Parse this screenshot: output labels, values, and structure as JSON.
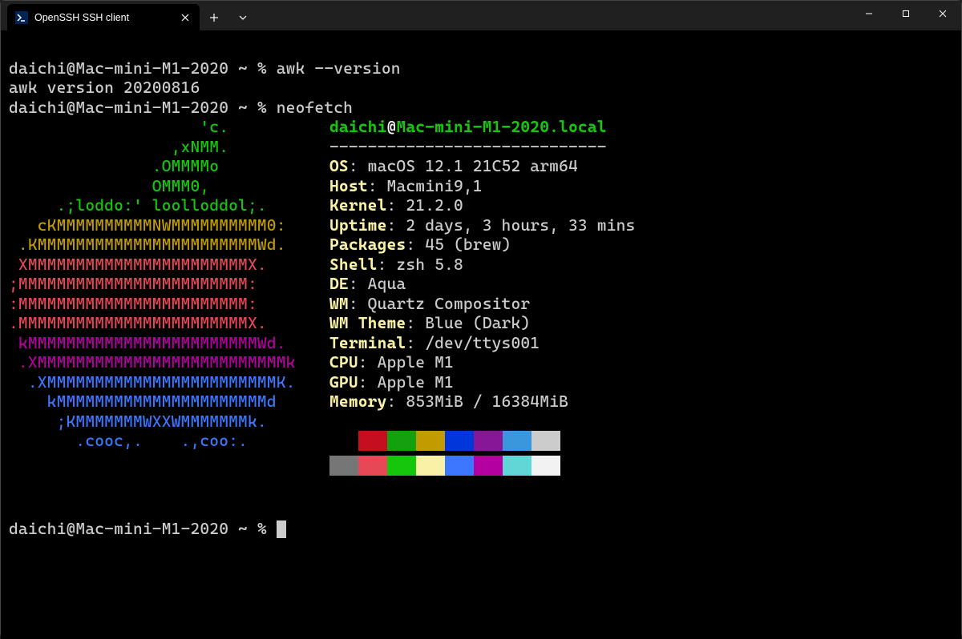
{
  "tab": {
    "title": "OpenSSH SSH client"
  },
  "prompt": "daichi@Mac-mini-M1-2020 ~ % ",
  "cmd1": "awk --version",
  "out1": "awk version 20200816",
  "cmd2": "neofetch",
  "ascii": [
    "                    'c.",
    "                 ,xNMM.",
    "               .OMMMMo",
    "               OMMM0,",
    "     .;loddo:' loolloddol;.",
    "   cKMMMMMMMMMMNWMMMMMMMMMM0:",
    " .KMMMMMMMMMMMMMMMMMMMMMMMWd.",
    " XMMMMMMMMMMMMMMMMMMMMMMMX.",
    ";MMMMMMMMMMMMMMMMMMMMMMMM:",
    ":MMMMMMMMMMMMMMMMMMMMMMMM:",
    ".MMMMMMMMMMMMMMMMMMMMMMMMX.",
    " kMMMMMMMMMMMMMMMMMMMMMMMMWd.",
    " .XMMMMMMMMMMMMMMMMMMMMMMMMMMk",
    "  .XMMMMMMMMMMMMMMMMMMMMMMMMK.",
    "    kMMMMMMMMMMMMMMMMMMMMMMd",
    "     ;KMMMMMMMWXXWMMMMMMMk.",
    "       .cooc,.    .,coo:."
  ],
  "user": "daichi",
  "at": "@",
  "host": "Mac-mini-M1-2020.local",
  "dashes": "-----------------------------",
  "info": [
    {
      "label": "OS",
      "value": "macOS 12.1 21C52 arm64"
    },
    {
      "label": "Host",
      "value": "Macmini9,1"
    },
    {
      "label": "Kernel",
      "value": "21.2.0"
    },
    {
      "label": "Uptime",
      "value": "2 days, 3 hours, 33 mins"
    },
    {
      "label": "Packages",
      "value": "45 (brew)"
    },
    {
      "label": "Shell",
      "value": "zsh 5.8"
    },
    {
      "label": "DE",
      "value": "Aqua"
    },
    {
      "label": "WM",
      "value": "Quartz Compositor"
    },
    {
      "label": "WM Theme",
      "value": "Blue (Dark)"
    },
    {
      "label": "Terminal",
      "value": "/dev/ttys001"
    },
    {
      "label": "CPU",
      "value": "Apple M1"
    },
    {
      "label": "GPU",
      "value": "Apple M1"
    },
    {
      "label": "Memory",
      "value": "853MiB / 16384MiB"
    }
  ],
  "colors_row1": [
    "#000000",
    "#c50f1f",
    "#13a10e",
    "#c19c00",
    "#0037da",
    "#881798",
    "#3a96dd",
    "#cccccc"
  ],
  "colors_row2": [
    "#767676",
    "#e74856",
    "#16c60c",
    "#f9f1a5",
    "#3b78ff",
    "#b4009e",
    "#61d6d6",
    "#f2f2f2"
  ],
  "ascii_colors": [
    "green",
    "green",
    "green",
    "green",
    "green",
    "yellowd",
    "yellowd",
    "red",
    "red",
    "red",
    "red",
    "mag",
    "mag",
    "blue",
    "blue",
    "blue",
    "blue"
  ]
}
